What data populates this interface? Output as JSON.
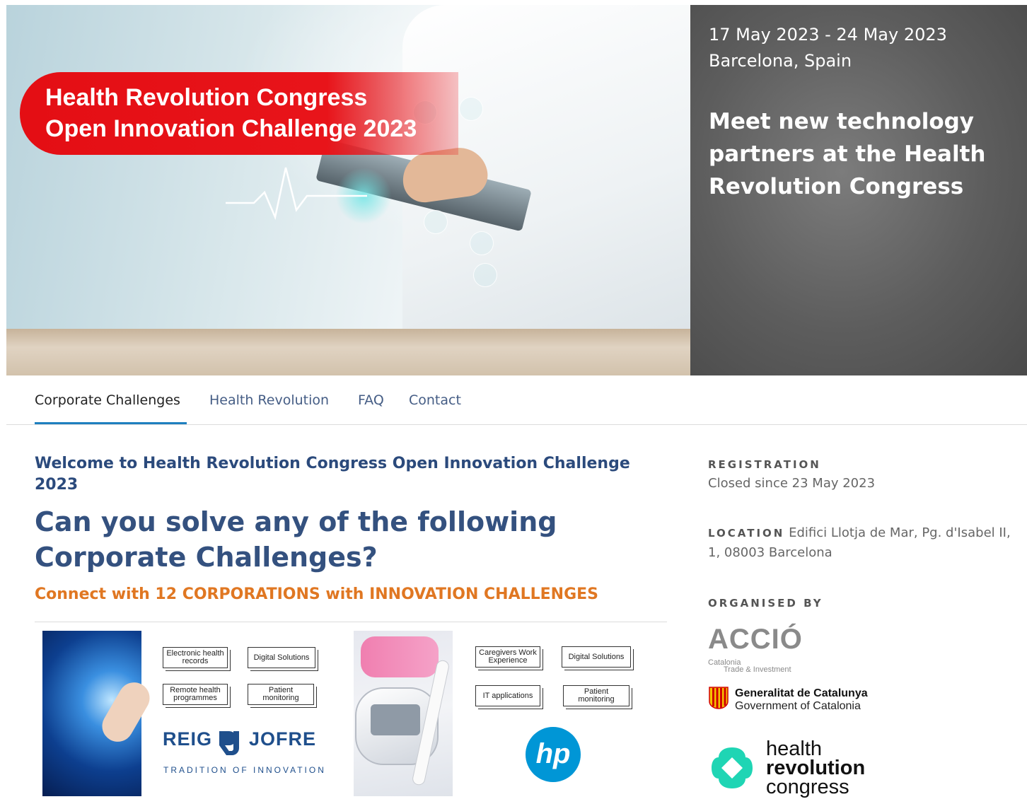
{
  "hero": {
    "badge_line1": "Health Revolution Congress",
    "badge_line2": "Open Innovation Challenge 2023",
    "dates": "17 May 2023 - 24 May 2023",
    "location": "Barcelona, Spain",
    "tagline": "Meet new technology partners at the Health Revolution Congress",
    "badge_color": "#e40e14"
  },
  "nav": {
    "tabs": [
      {
        "label": "Corporate Challenges",
        "active": true
      },
      {
        "label": "Health Revolution",
        "active": false
      },
      {
        "label": "FAQ",
        "active": false
      },
      {
        "label": "Contact",
        "active": false
      }
    ],
    "active_underline_color": "#1e7fbf"
  },
  "main": {
    "welcome": "Welcome to Health Revolution Congress Open Innovation Challenge 2023",
    "headline": "Can you solve any of the following Corporate Challenges?",
    "connect": "Connect with 12 CORPORATIONS with INNOVATION CHALLENGES",
    "cards": [
      {
        "company": "REIG JOFRE",
        "company_part1": "REIG",
        "company_part2": "JOFRE",
        "company_tagline": "TRADITION OF INNOVATION",
        "chips": [
          "Electronic health records",
          "Digital Solutions",
          "Remote health programmes",
          "Patient monitoring"
        ]
      },
      {
        "company": "hp",
        "chips": [
          "Caregivers Work Experience",
          "Digital Solutions",
          "IT applications",
          "Patient monitoring"
        ]
      }
    ]
  },
  "sidebar": {
    "registration_label": "REGISTRATION",
    "registration_value": "Closed since 23 May 2023",
    "location_label": "LOCATION",
    "location_value": "Edifici Llotja de Mar, Pg. d'Isabel II, 1, 08003 Barcelona",
    "organised_label": "ORGANISED BY",
    "organisers": {
      "accio": {
        "name": "ACCIÓ",
        "sub1": "Catalonia",
        "sub2": "Trade & Investment"
      },
      "gencat": {
        "line1": "Generalitat de Catalunya",
        "line2": "Government of Catalonia"
      },
      "hrc": {
        "line1": "health",
        "line2": "revolution",
        "line3": "congress",
        "color": "#1fd5b4"
      }
    }
  }
}
